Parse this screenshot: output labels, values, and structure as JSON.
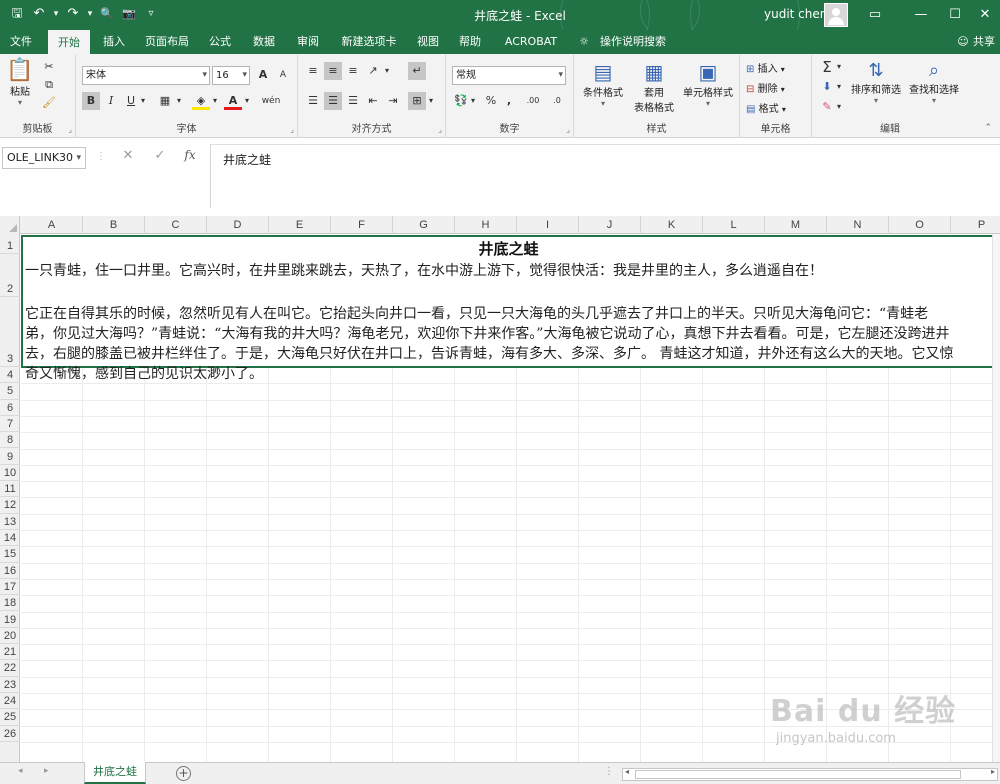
{
  "titlebar": {
    "title": "井底之蛙  -  Excel",
    "user": "yudit chen",
    "qat": {
      "save": "🖫",
      "undo": "↶",
      "undo_dd": "▾",
      "redo": "↷",
      "redo_dd": "▾",
      "preview": "🔍",
      "camera": "📷",
      "customize": "▿"
    },
    "controls": {
      "ribbon_opts": "▭",
      "minimize": "—",
      "maximize": "☐",
      "close": "✕"
    }
  },
  "tabs": [
    "文件",
    "开始",
    "插入",
    "页面布局",
    "公式",
    "数据",
    "审阅",
    "新建选项卡",
    "视图",
    "帮助",
    "ACROBAT"
  ],
  "active_tab": "开始",
  "tellme": "操作说明搜索",
  "share": "共享",
  "ribbon": {
    "clipboard": {
      "label": "剪贴板",
      "paste": "粘贴"
    },
    "font": {
      "label": "字体",
      "name": "宋体",
      "size": "16",
      "grow": "A",
      "shrink": "A",
      "bold": "B",
      "italic": "I",
      "underline": "U",
      "wen": "wén"
    },
    "alignment": {
      "label": "对齐方式"
    },
    "number": {
      "label": "数字",
      "format": "常规",
      "percent": "%",
      "comma": ",",
      "inc": ".00",
      "dec": ".0"
    },
    "styles": {
      "label": "样式",
      "cond": "条件格式",
      "table_line1": "套用",
      "table_line2": "表格格式",
      "cell": "单元格样式"
    },
    "cells": {
      "label": "单元格",
      "insert": "插入",
      "delete": "删除",
      "format": "格式"
    },
    "editing": {
      "label": "编辑",
      "sort": "排序和筛选",
      "find": "查找和选择"
    }
  },
  "formula": {
    "name_box": "OLE_LINK30",
    "cancel": "✕",
    "enter": "✓",
    "fx": "fx",
    "content": "井底之蛙"
  },
  "columns": [
    "A",
    "B",
    "C",
    "D",
    "E",
    "F",
    "G",
    "H",
    "I",
    "J",
    "K",
    "L",
    "M",
    "N",
    "O",
    "P"
  ],
  "rows": [
    "1",
    "2",
    "3",
    "4",
    "5",
    "6",
    "7",
    "8",
    "9",
    "10",
    "11",
    "12",
    "13",
    "14",
    "15",
    "16",
    "17",
    "18",
    "19",
    "20",
    "21",
    "22",
    "23",
    "24",
    "25",
    "26"
  ],
  "cell": {
    "title": "井底之蛙",
    "para1": "一只青蛙，住一口井里。它高兴时，在井里跳来跳去，天热了，在水中游上游下，觉得很快活：我是井里的主人，多么逍遥自在！",
    "para2": "  它正在自得其乐的时候，忽然听见有人在叫它。它抬起头向井口一看，只见一只大海龟的头几乎遮去了井口上的半天。只听见大海龟问它：“青蛙老弟，你见过大海吗？”青蛙说：“大海有我的井大吗？海龟老兄，欢迎你下井来作客。”大海龟被它说动了心，真想下井去看看。可是，它左腿还没跨进井去，右腿的膝盖已被井栏绊住了。于是，大海龟只好伏在井口上，告诉青蛙，海有多大、多深、多广。 青蛙这才知道，井外还有这么大的天地。它又惊奇又惭愧，感到自己的见识太渺小了。"
  },
  "watermark": {
    "logo": "Bai du 经验",
    "url": "jingyan.baidu.com"
  },
  "sheets": {
    "active": "井底之蛙",
    "add": "⊕",
    "prev": "◂",
    "next": "▸",
    "more": "⋮"
  },
  "colors": {
    "excel_green": "#217346",
    "ribbon_bg": "#f3f3f3",
    "header_bg": "#f0f0f0"
  }
}
